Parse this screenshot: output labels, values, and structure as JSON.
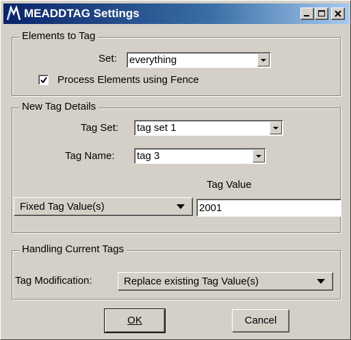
{
  "window": {
    "title": "MEADDTAG Settings",
    "app_icon": "microstation-icon",
    "minimize_icon": "minimize-icon",
    "maximize_icon": "maximize-icon",
    "close_icon": "close-icon"
  },
  "elements_to_tag": {
    "legend": "Elements to Tag",
    "set_label": "Set:",
    "set_value": "everything",
    "fence_checked": true,
    "fence_label": "Process Elements using Fence"
  },
  "new_tag_details": {
    "legend": "New Tag Details",
    "tag_set_label": "Tag Set:",
    "tag_set_value": "tag set 1",
    "tag_name_label": "Tag Name:",
    "tag_name_value": "tag 3",
    "tag_value_header": "Tag Value",
    "value_mode": "Fixed Tag Value(s)",
    "tag_value": "2001"
  },
  "handling_current_tags": {
    "legend": "Handling Current Tags",
    "modification_label": "Tag Modification:",
    "modification_value": "Replace existing Tag Value(s)"
  },
  "buttons": {
    "ok": "OK",
    "cancel": "Cancel"
  }
}
